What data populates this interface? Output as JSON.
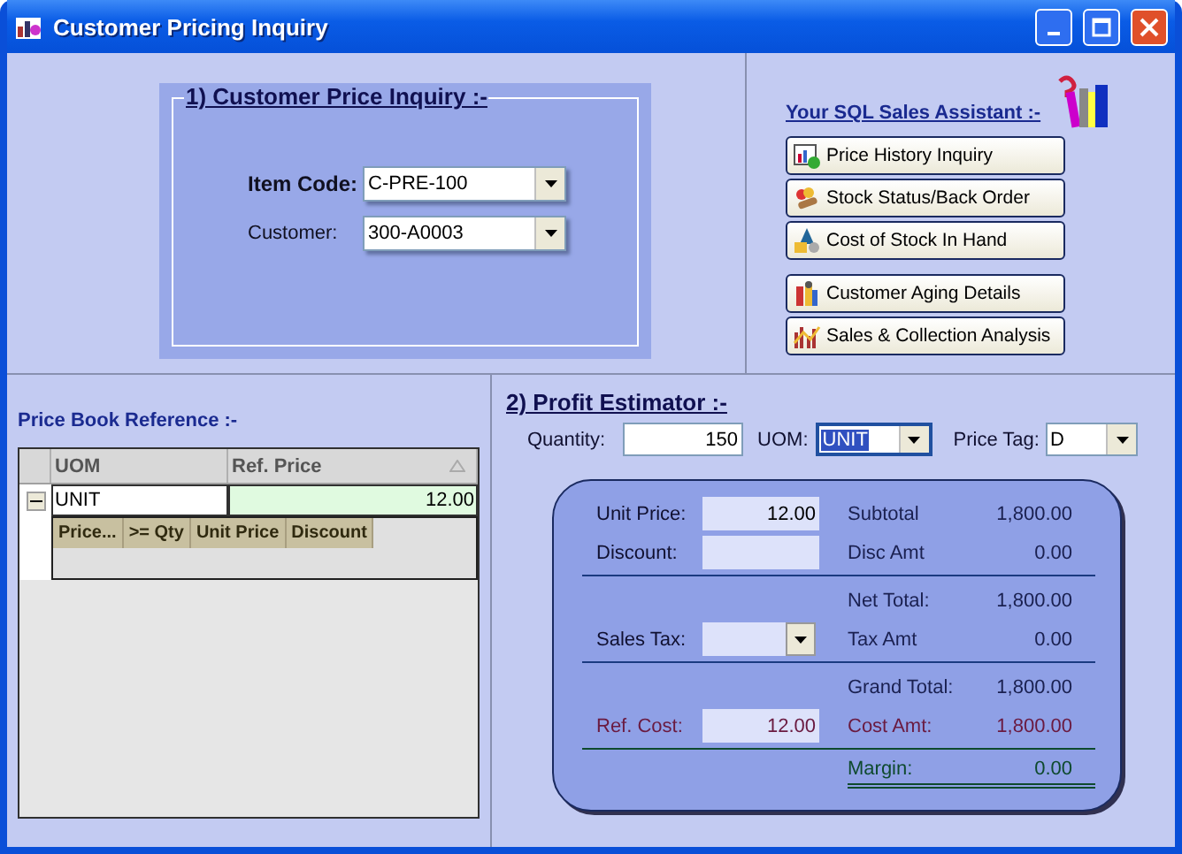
{
  "window": {
    "title": "Customer Pricing Inquiry"
  },
  "inquiry": {
    "title": "1) Customer Price Inquiry :-",
    "fields": [
      {
        "label": "Item Code:",
        "value": "C-PRE-100",
        "bold": true
      },
      {
        "label": "Customer:",
        "value": "300-A0003",
        "bold": false
      }
    ]
  },
  "assistant": {
    "title": "Your SQL Sales Assistant :-",
    "groups": [
      [
        {
          "label": "Price History Inquiry",
          "kind": "chart"
        },
        {
          "label": "Stock Status/Back Order",
          "kind": "stock"
        },
        {
          "label": "Cost of Stock In Hand",
          "kind": "cost"
        }
      ],
      [
        {
          "label": "Customer Aging Details",
          "kind": "aging"
        },
        {
          "label": "Sales & Collection Analysis",
          "kind": "sales"
        }
      ]
    ]
  },
  "price_book": {
    "title": "Price Book Reference :-",
    "columns": [
      "UOM",
      "Ref. Price"
    ],
    "rows": [
      {
        "uom": "UNIT",
        "ref_price": "12.00",
        "expanded": true,
        "sub_columns": [
          "Price...",
          ">= Qty",
          "Unit Price",
          "Discount"
        ]
      }
    ]
  },
  "estimator": {
    "title": "2) Profit Estimator :-",
    "quantity": {
      "label": "Quantity:",
      "value": "150"
    },
    "uom": {
      "label": "UOM:",
      "value": "UNIT"
    },
    "price_tag": {
      "label": "Price Tag:",
      "value": "D"
    },
    "sections": [
      [
        {
          "left": {
            "label": "Unit Price:",
            "value": "12.00",
            "kind": "input"
          },
          "right": {
            "label": "Subtotal",
            "value": "1,800.00"
          }
        },
        {
          "left": {
            "label": "Discount:",
            "kind": "input"
          },
          "right": {
            "label": "Disc Amt",
            "value": "0.00"
          }
        }
      ],
      [
        {
          "right": {
            "label": "Net Total:",
            "value": "1,800.00"
          }
        },
        {
          "left": {
            "label": "Sales Tax:",
            "kind": "select"
          },
          "right": {
            "label": "Tax Amt",
            "value": "0.00"
          }
        }
      ],
      [
        {
          "right": {
            "label": "Grand Total:",
            "value": "1,800.00"
          }
        },
        {
          "left": {
            "label": "Ref. Cost:",
            "value": "12.00",
            "kind": "input",
            "color": "#6a1a40"
          },
          "right": {
            "label": "Cost Amt:",
            "value": "1,800.00",
            "color": "#6a1a40"
          }
        }
      ],
      [
        {
          "right": {
            "label": "Margin:",
            "value": "0.00",
            "color": "#0e4a2e"
          }
        }
      ]
    ]
  }
}
